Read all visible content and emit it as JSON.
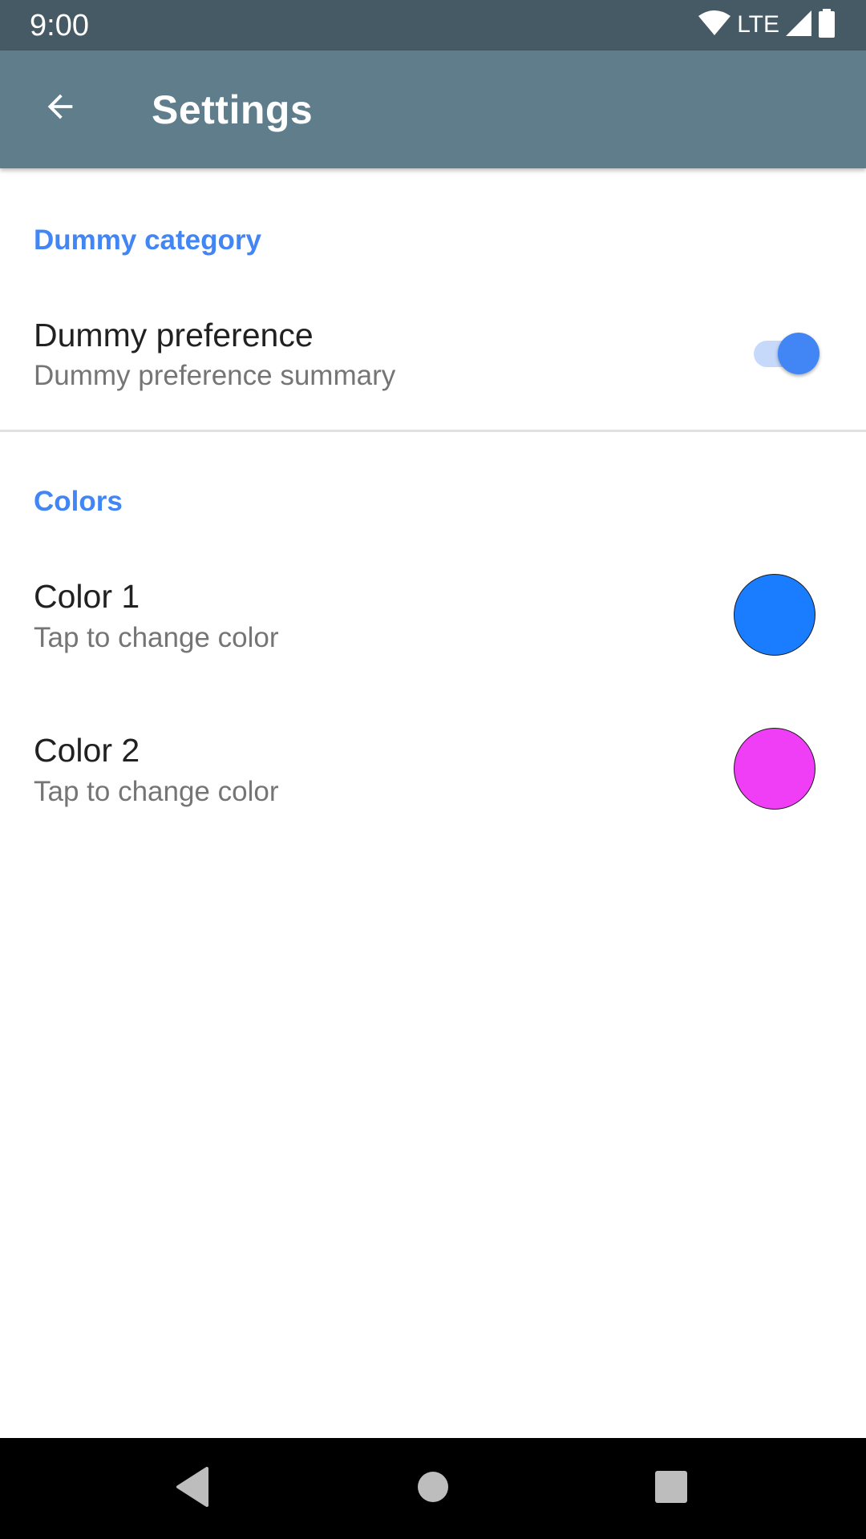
{
  "status_bar": {
    "time": "9:00",
    "network": "LTE",
    "icons": [
      "wifi-icon",
      "cellular-signal-icon",
      "battery-icon"
    ]
  },
  "app_bar": {
    "title": "Settings",
    "back_icon": "arrow-back-icon"
  },
  "categories": [
    {
      "title": "Dummy category",
      "preferences": [
        {
          "title": "Dummy preference",
          "summary": "Dummy preference summary",
          "widget": "switch",
          "checked": true
        }
      ]
    },
    {
      "title": "Colors",
      "preferences": [
        {
          "title": "Color 1",
          "summary": "Tap to change color",
          "widget": "color-swatch",
          "color": "#1a7cff"
        },
        {
          "title": "Color 2",
          "summary": "Tap to change color",
          "widget": "color-swatch",
          "color": "#f03ef7"
        }
      ]
    }
  ],
  "nav_bar": {
    "buttons": [
      "nav-back-icon",
      "nav-home-icon",
      "nav-recents-icon"
    ]
  },
  "colors": {
    "status_bar": "#455a64",
    "app_bar": "#607d8b",
    "accent": "#4285f4"
  }
}
